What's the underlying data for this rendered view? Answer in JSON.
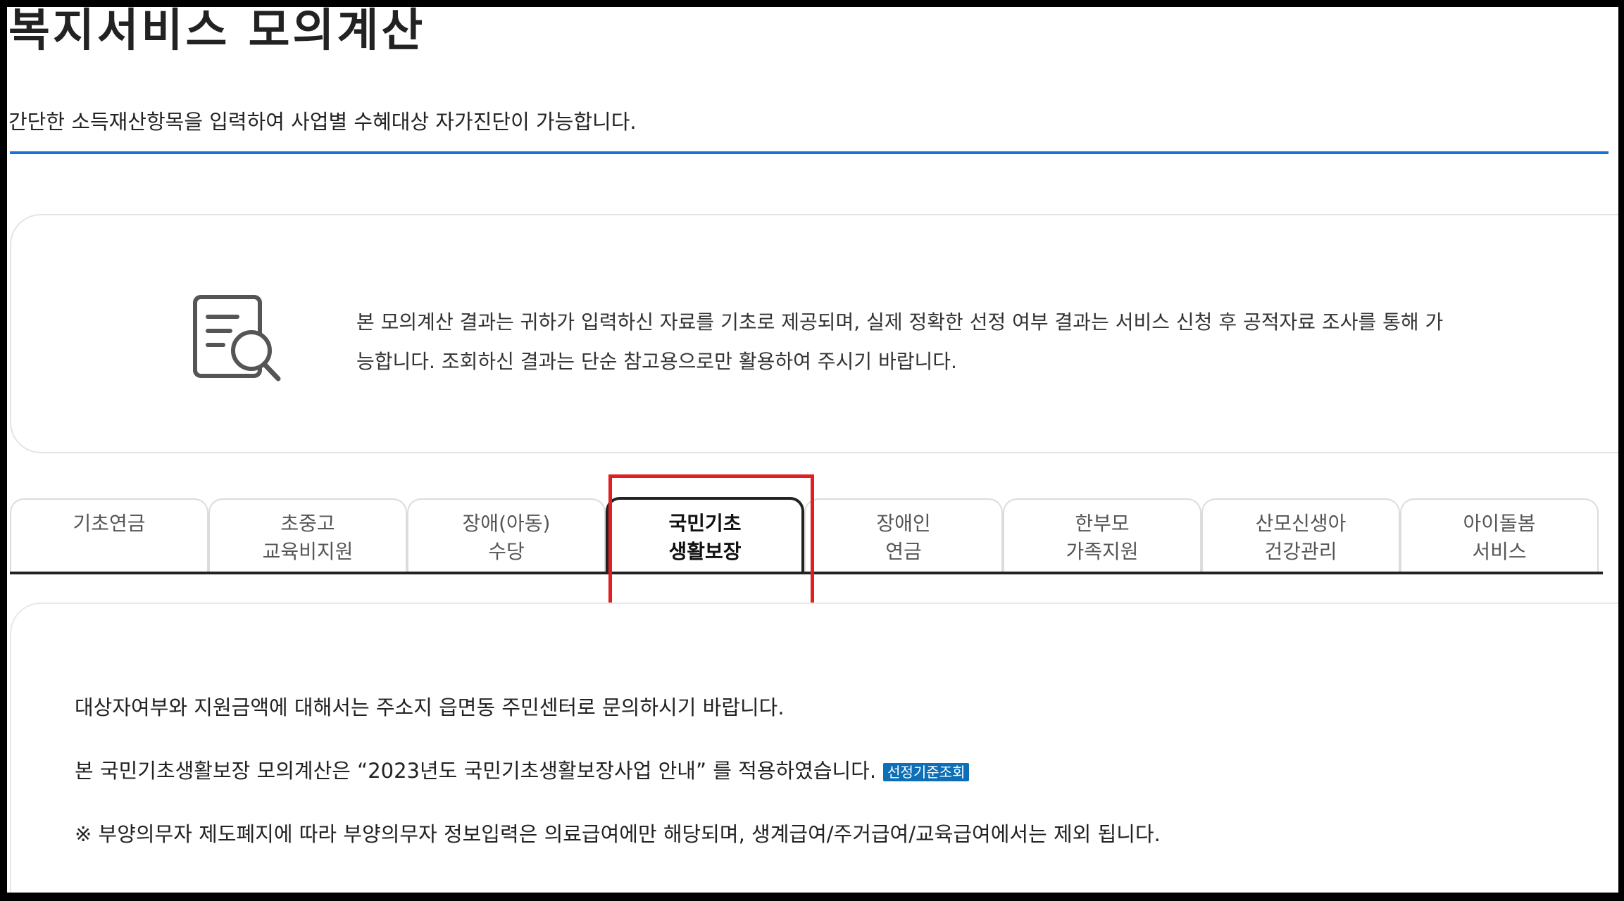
{
  "page": {
    "title": "복지서비스 모의계산",
    "description": "간단한 소득재산항목을 입력하여 사업별 수혜대상 자가진단이 가능합니다."
  },
  "notice": {
    "text": "본 모의계산 결과는 귀하가 입력하신 자료를 기초로 제공되며, 실제 정확한 선정 여부 결과는 서비스 신청 후 공적자료 조사를 통해 가능합니다. 조회하신 결과는 단순 참고용으로만 활용하여 주시기 바랍니다.",
    "icon": "document-search-icon"
  },
  "tabs": [
    {
      "line1": "기초연금",
      "line2": ""
    },
    {
      "line1": "초중고",
      "line2": "교육비지원"
    },
    {
      "line1": "장애(아동)",
      "line2": "수당"
    },
    {
      "line1": "국민기초",
      "line2": "생활보장",
      "active": true
    },
    {
      "line1": "장애인",
      "line2": "연금"
    },
    {
      "line1": "한부모",
      "line2": "가족지원"
    },
    {
      "line1": "산모신생아",
      "line2": "건강관리"
    },
    {
      "line1": "아이돌봄",
      "line2": "서비스"
    }
  ],
  "content": {
    "line1": "대상자여부와 지원금액에 대해서는 주소지 읍면동 주민센터로 문의하시기 바랍니다.",
    "line2": "본 국민기초생활보장 모의계산은 “2023년도 국민기초생활보장사업 안내” 를 적용하였습니다.",
    "badge": "선정기준조회",
    "line3": "※ 부양의무자 제도폐지에 따라 부양의무자 정보입력은 의료급여에만 해당되며, 생계급여/주거급여/교육급여에서는 제외 됩니다."
  },
  "colors": {
    "accent_blue": "#1a73d1",
    "highlight_red": "#e02020",
    "badge_blue": "#0d6fb8"
  }
}
